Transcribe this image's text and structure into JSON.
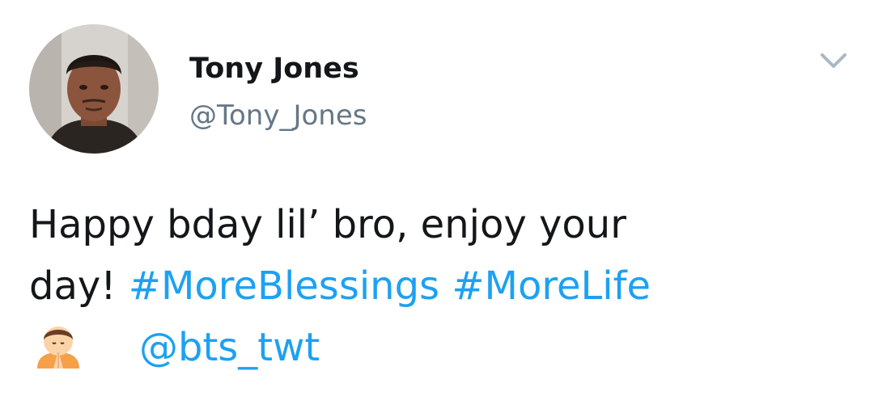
{
  "tweet": {
    "author": {
      "display_name": "Tony Jones",
      "handle": "@Tony_Jones"
    },
    "text": {
      "line1": "Happy bday lil’ bro, enjoy your",
      "line2_plain": "day! ",
      "hashtags": [
        "#MoreBlessings",
        "#MoreLife"
      ],
      "mention": "@bts_twt"
    },
    "icons": {
      "menu": "chevron-down-icon",
      "emoji": "person-with-folded-hands-emoji"
    }
  },
  "colors": {
    "link": "#1da1f2",
    "text": "#14171a",
    "secondary": "#657786",
    "caret": "#aab8c2"
  }
}
